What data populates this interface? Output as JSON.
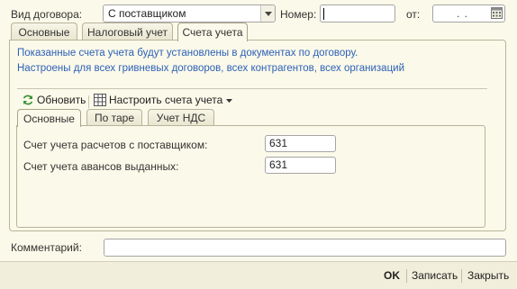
{
  "form": {
    "contract_type_label": "Вид договора:",
    "contract_type_value": "С поставщиком",
    "number_label": "Номер:",
    "number_value": "",
    "date_label": "от:",
    "date_value": ". ."
  },
  "tabs": [
    {
      "label": "Основные"
    },
    {
      "label": "Налоговый учет"
    },
    {
      "label": "Счета учета",
      "active": true
    }
  ],
  "accounts_tab": {
    "info_line1": "Показанные счета учета будут установлены в документах по договору.",
    "info_line2": "Настроены для всех гривневых договоров, всех контрагентов, всех организаций",
    "toolbar": {
      "refresh_label": "Обновить",
      "configure_label": "Настроить счета учета"
    },
    "inner_tabs": [
      {
        "label": "Основные",
        "active": true
      },
      {
        "label": "По таре"
      },
      {
        "label": "Учет НДС"
      }
    ],
    "fields": [
      {
        "label": "Счет учета расчетов с поставщиком:",
        "value": "631"
      },
      {
        "label": "Счет учета авансов выданных:",
        "value": "631"
      }
    ]
  },
  "comment": {
    "label": "Комментарий:",
    "value": ""
  },
  "bottom_bar": {
    "ok_label": "OK",
    "save_label": "Записать",
    "close_label": "Закрыть"
  },
  "colors": {
    "background": "#fbf9e9",
    "info_text": "#2d61b8",
    "bottom_bar": "#f1eedb"
  }
}
